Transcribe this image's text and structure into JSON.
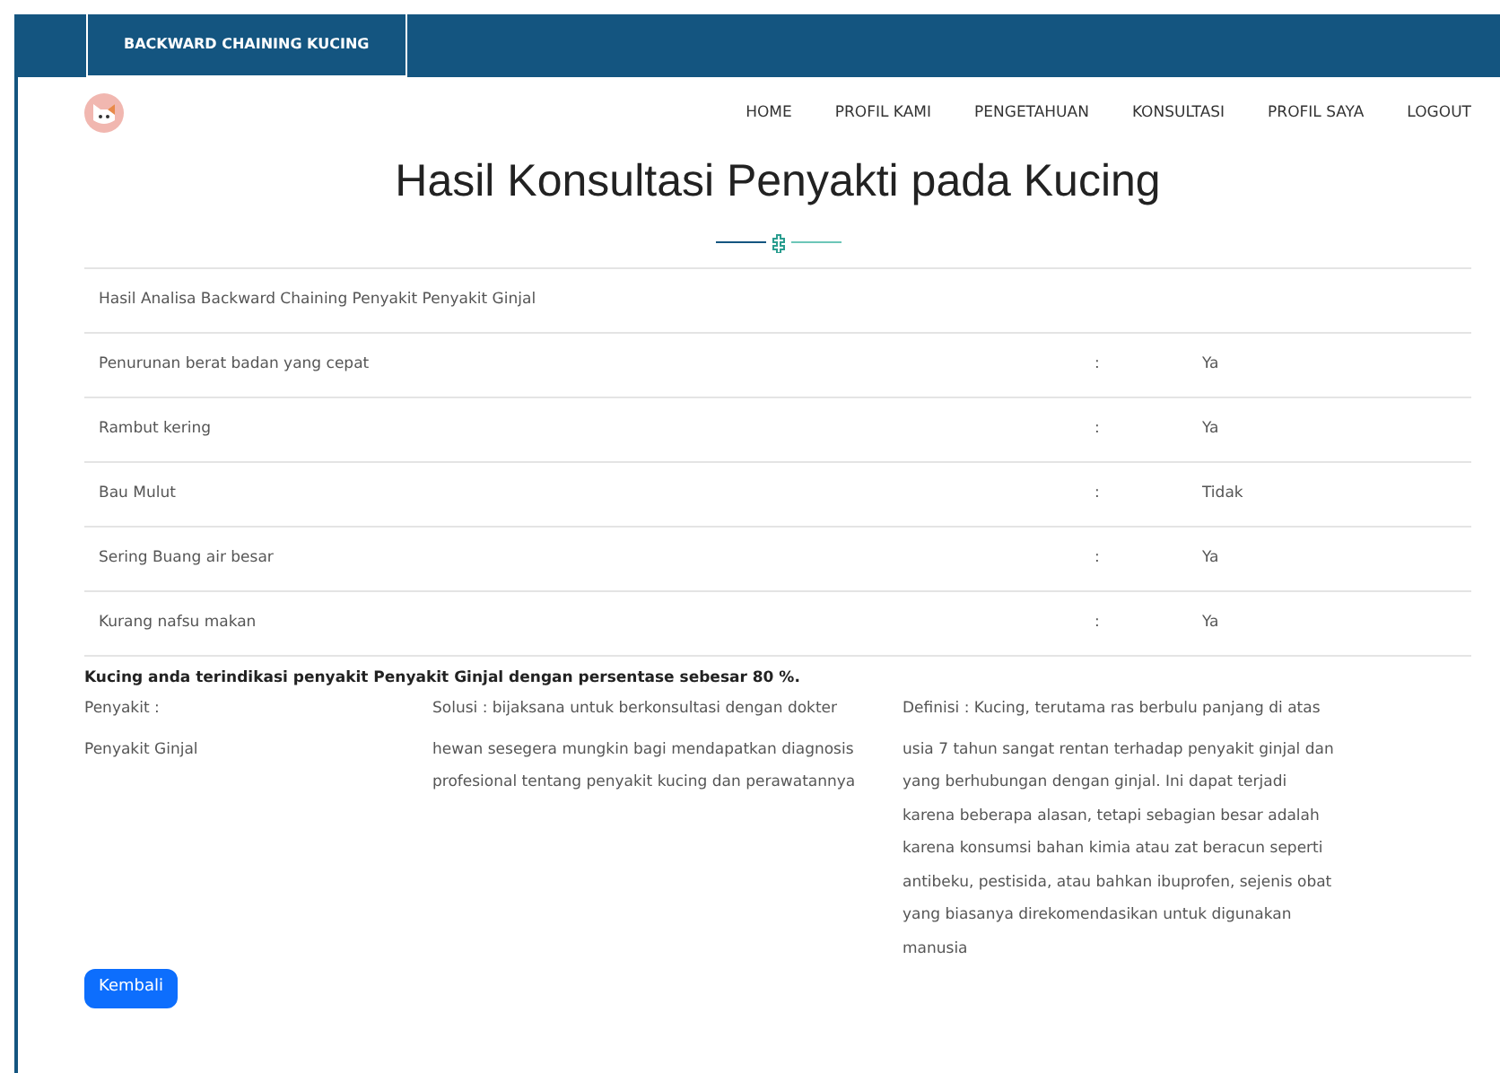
{
  "top_bar": {
    "brand": "BACKWARD CHAINING KUCING"
  },
  "nav": {
    "items": [
      {
        "label": "HOME",
        "selected": false
      },
      {
        "label": "PROFIL KAMI",
        "selected": false
      },
      {
        "label": "PENGETAHUAN",
        "selected": false
      },
      {
        "label": "KONSULTASI",
        "selected": false
      },
      {
        "label": "PROFIL SAYA",
        "selected": false
      },
      {
        "label": "LOGOUT",
        "selected": false
      }
    ]
  },
  "title": "Hasil Konsultasi Penyakti pada Kucing",
  "table": {
    "heading": "Hasil Analisa Backward Chaining Penyakit Penyakit Ginjal",
    "rows": [
      {
        "symptom": "Penurunan berat badan yang cepat",
        "separator": ":",
        "answer": "Ya"
      },
      {
        "symptom": "Rambut kering",
        "separator": ":",
        "answer": "Ya"
      },
      {
        "symptom": "Bau Mulut",
        "separator": ":",
        "answer": "Tidak"
      },
      {
        "symptom": "Sering Buang air besar",
        "separator": ":",
        "answer": "Ya"
      },
      {
        "symptom": "Kurang nafsu makan",
        "separator": ":",
        "answer": "Ya"
      }
    ]
  },
  "result": "Kucing anda terindikasi penyakit Penyakit Ginjal dengan persentase sebesar 80 %.",
  "details": {
    "disease_label": "Penyakit :",
    "disease": "Penyakit Ginjal",
    "solution_lines": [
      "Solusi : bijaksana untuk berkonsultasi dengan dokter",
      "hewan sesegera mungkin bagi mendapatkan diagnosis",
      "profesional tentang penyakit kucing dan perawatannya"
    ],
    "definition_lines": [
      "Definisi : Kucing, terutama ras berbulu panjang di atas",
      "usia 7 tahun sangat rentan terhadap penyakit ginjal dan",
      "yang berhubungan dengan ginjal. Ini dapat terjadi",
      "karena beberapa alasan, tetapi sebagian besar adalah",
      "karena konsumsi bahan kimia atau zat beracun seperti",
      "antibeku, pestisida, atau bahkan ibuprofen, sejenis obat",
      "yang biasanya direkomendasikan untuk digunakan",
      "manusia"
    ]
  },
  "back_button": "Kembali"
}
